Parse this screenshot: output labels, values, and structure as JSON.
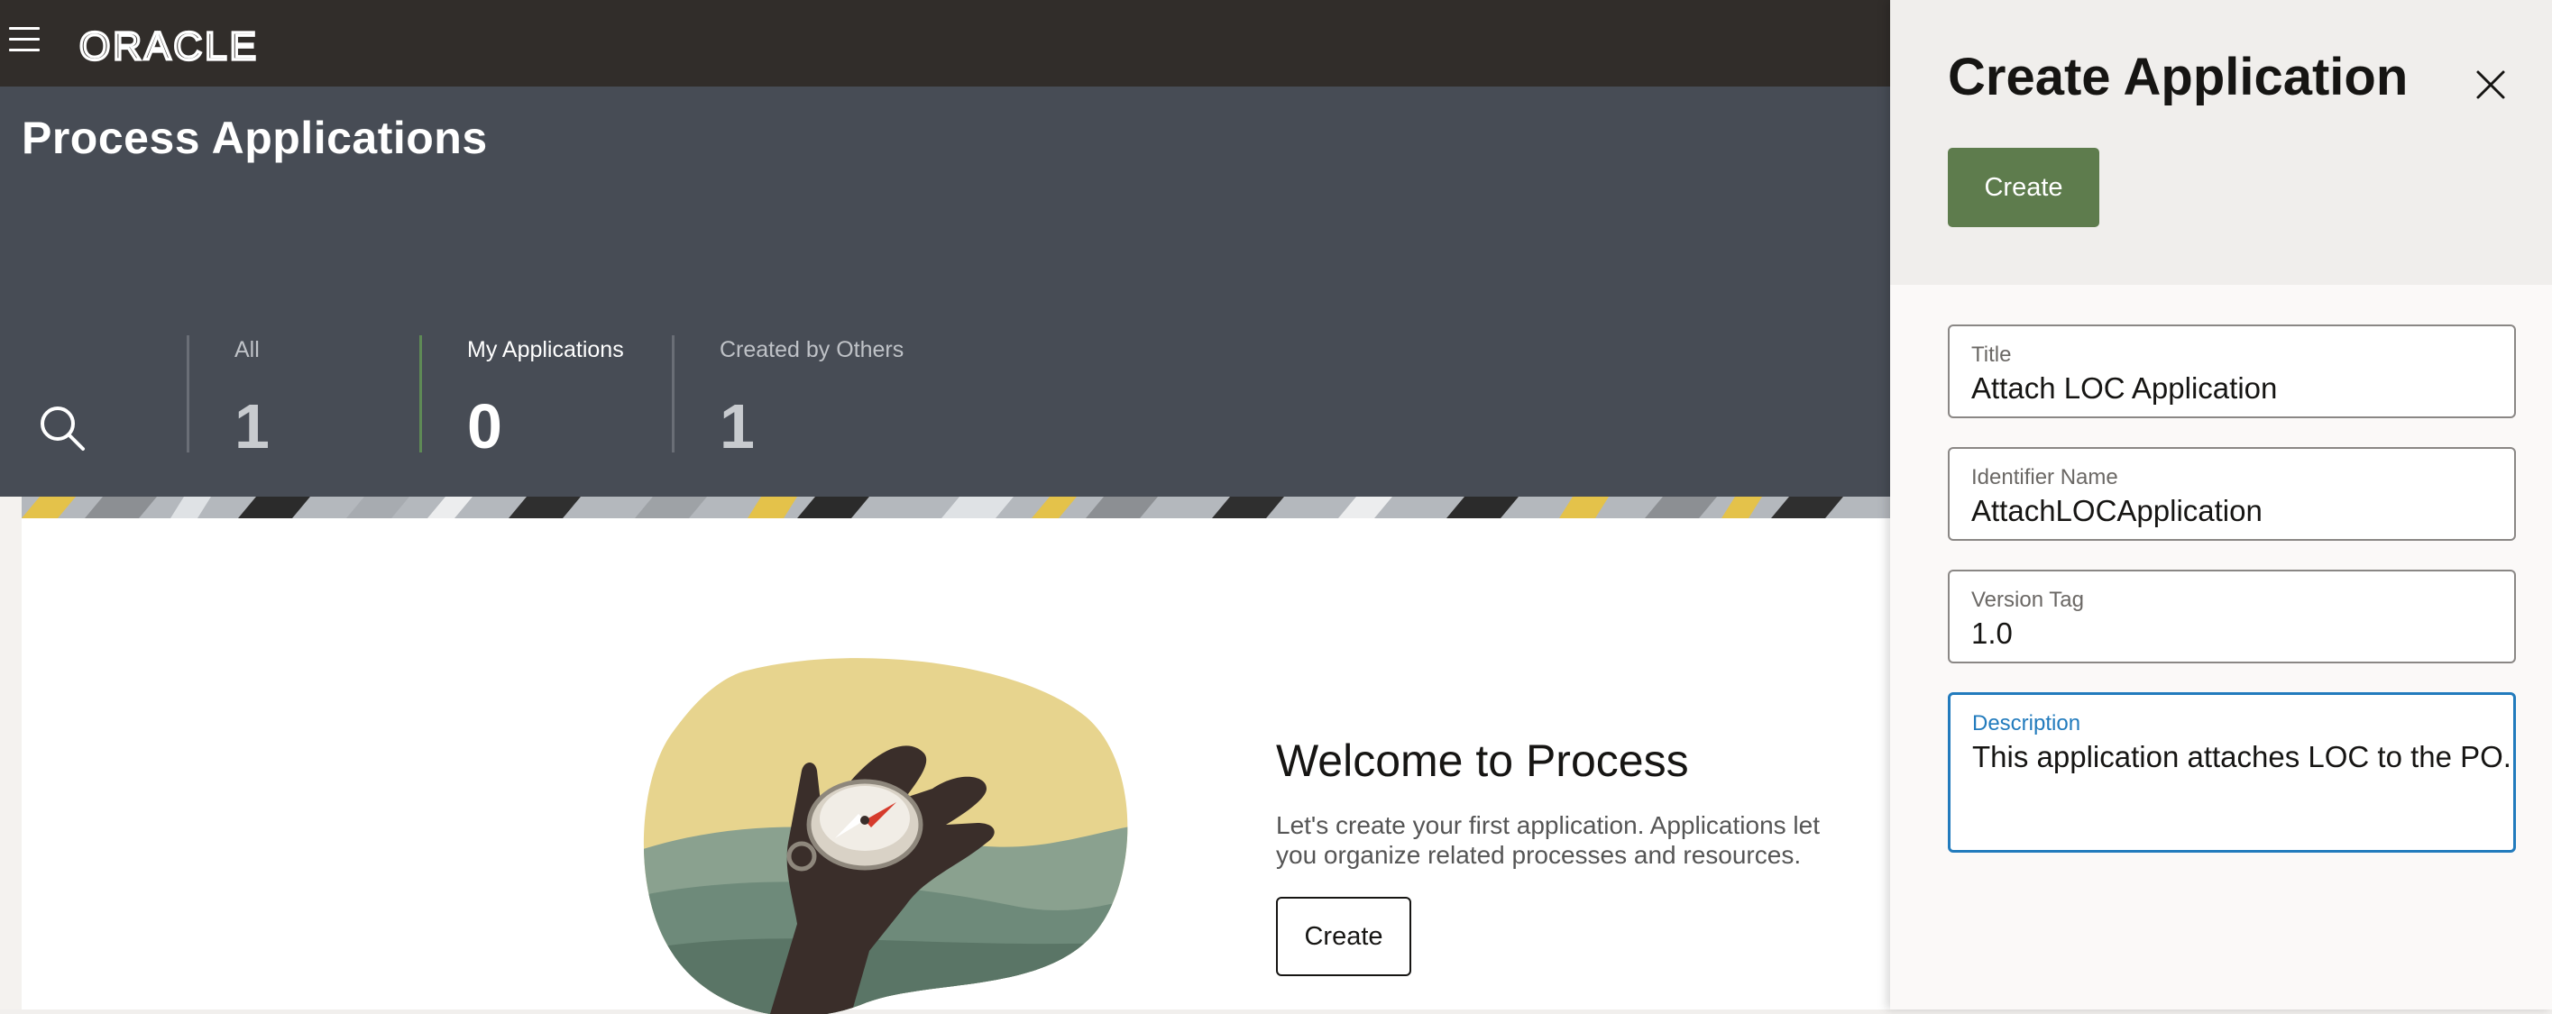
{
  "brand": {
    "logo_text": "ORACLE"
  },
  "header": {
    "title": "Process Applications",
    "stats": [
      {
        "label": "All",
        "count": "1"
      },
      {
        "label": "My Applications",
        "count": "0"
      },
      {
        "label": "Created by Others",
        "count": "1"
      }
    ]
  },
  "welcome": {
    "title": "Welcome to Process",
    "text": "Let's create your first application. Applications let you organize related processes and resources.",
    "create_label": "Create"
  },
  "panel": {
    "title": "Create Application",
    "create_label": "Create",
    "fields": {
      "title": {
        "label": "Title",
        "value": "Attach LOC Application"
      },
      "identifier": {
        "label": "Identifier Name",
        "value": "AttachLOCApplication"
      },
      "version": {
        "label": "Version Tag",
        "value": "1.0"
      },
      "description": {
        "label": "Description",
        "value": "This application attaches LOC to the PO."
      }
    }
  },
  "colors": {
    "topbar": "#312d2a",
    "header": "#474c55",
    "accent_green": "#5e7c4d",
    "active_tab_border": "#5e8a55",
    "focus_blue": "#227bbd"
  },
  "icons": [
    "hamburger-menu-icon",
    "search-icon",
    "close-icon",
    "compass-hand-illustration"
  ]
}
